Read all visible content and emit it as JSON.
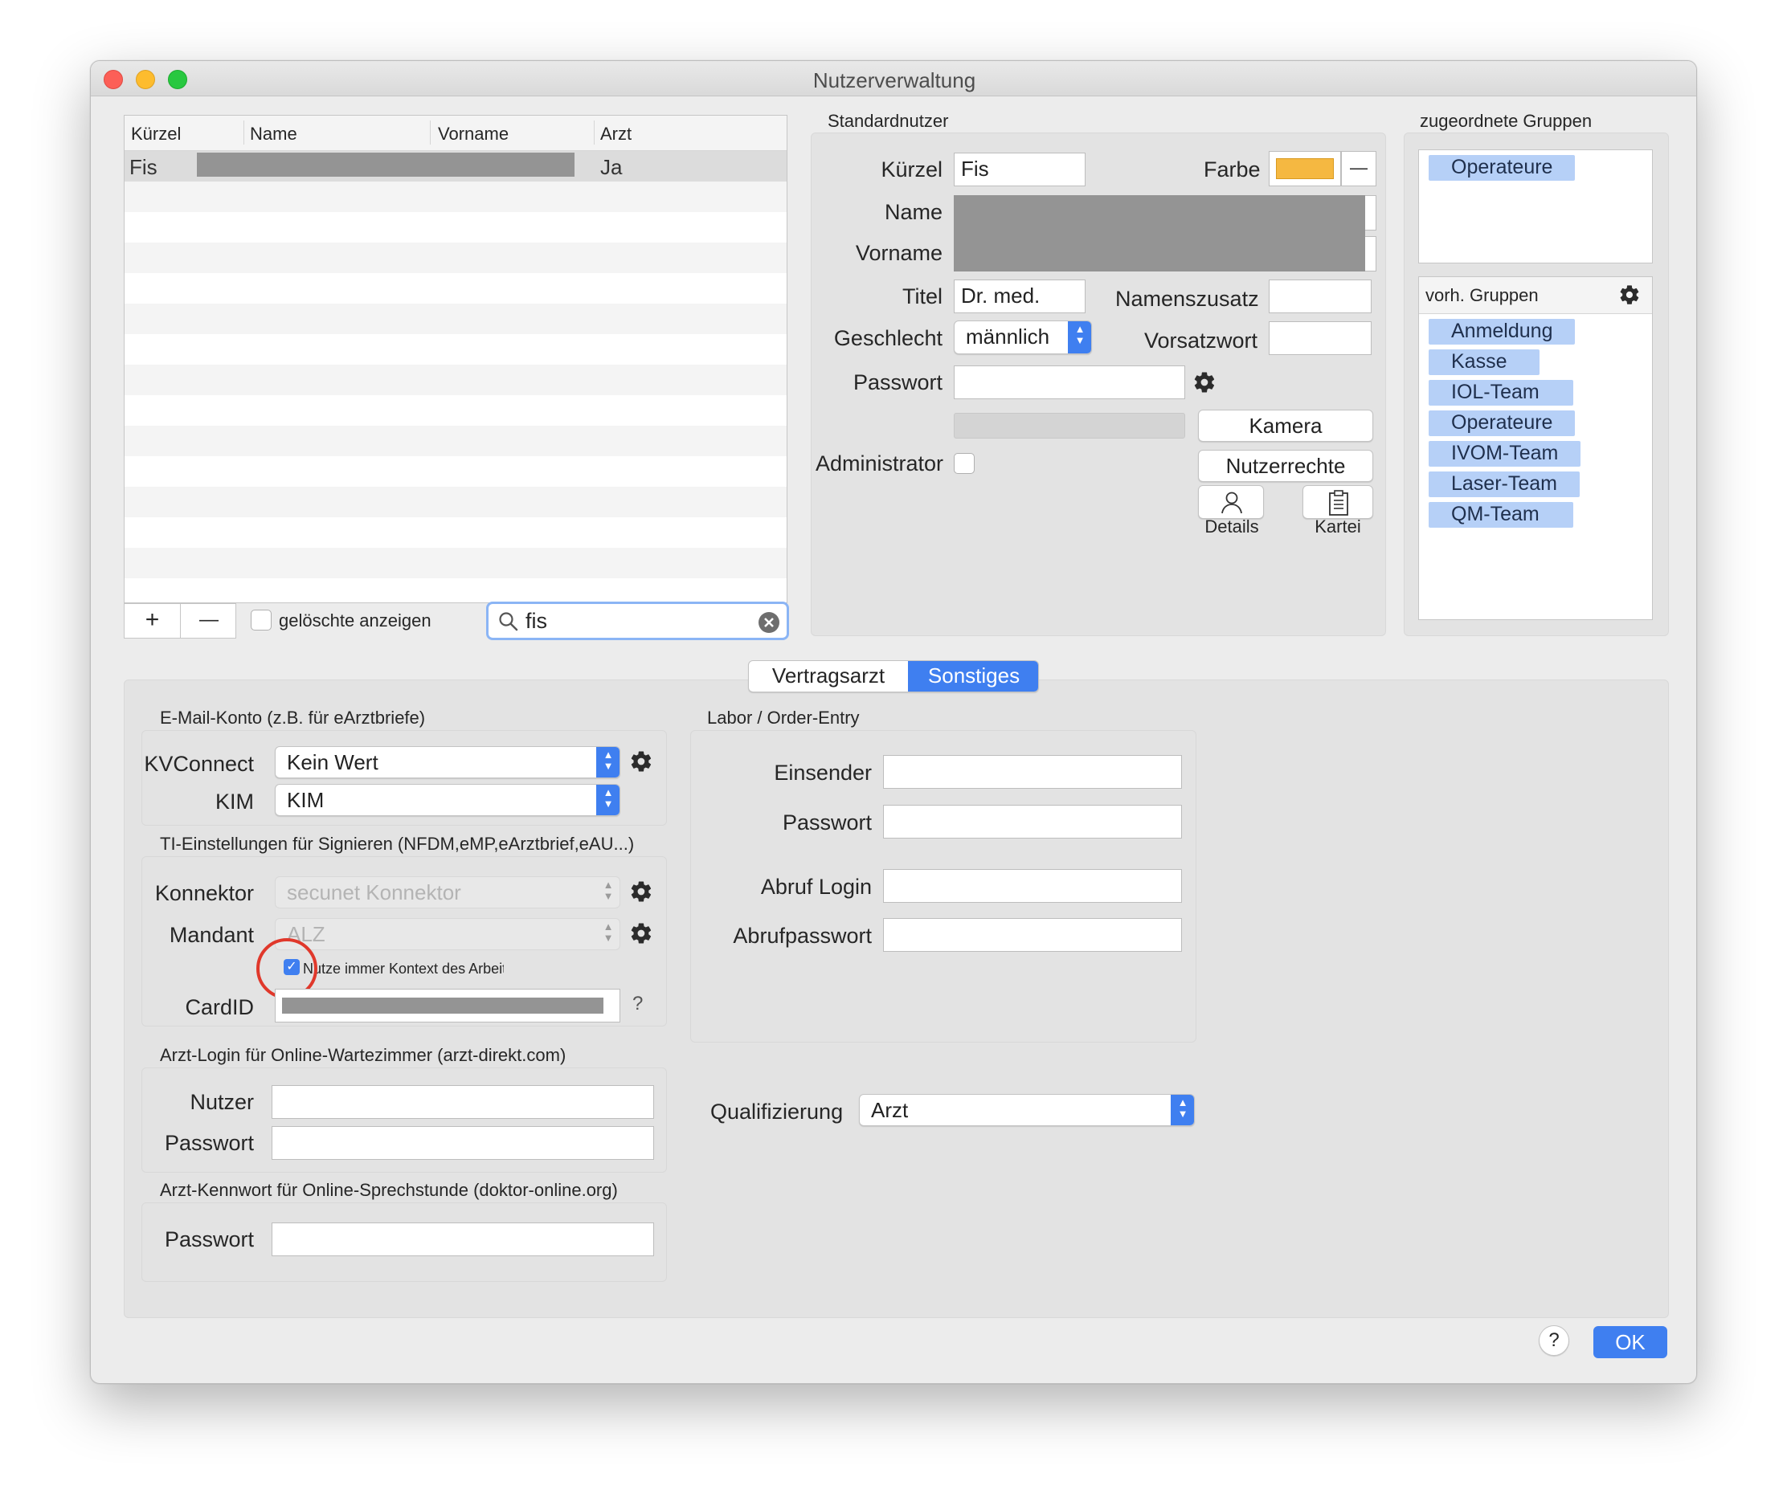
{
  "window": {
    "title": "Nutzerverwaltung"
  },
  "user_table": {
    "columns": [
      "Kürzel",
      "Name",
      "Vorname",
      "Arzt"
    ],
    "rows": [
      {
        "kuerzel": "Fis",
        "arzt": "Ja"
      }
    ],
    "add_label": "+",
    "remove_label": "—",
    "show_deleted_label": "gelöschte anzeigen",
    "search_value": "fis"
  },
  "standard_user": {
    "section_title": "Standardnutzer",
    "kuerzel_label": "Kürzel",
    "kuerzel_value": "Fis",
    "farbe_label": "Farbe",
    "farbe_color": "#f5b841",
    "farbe_remove": "—",
    "name_label": "Name",
    "vorname_label": "Vorname",
    "titel_label": "Titel",
    "titel_value": "Dr. med.",
    "namenszusatz_label": "Namenszusatz",
    "geschlecht_label": "Geschlecht",
    "geschlecht_value": "männlich",
    "vorsatzwort_label": "Vorsatzwort",
    "passwort_label": "Passwort",
    "kamera_label": "Kamera",
    "administrator_label": "Administrator",
    "nutzerrechte_label": "Nutzerrechte",
    "details_label": "Details",
    "kartei_label": "Kartei"
  },
  "groups": {
    "assigned_title": "zugeordnete Gruppen",
    "assigned": [
      "Operateure"
    ],
    "available_title": "vorh. Gruppen",
    "available": [
      "Anmeldung",
      "Kasse",
      "IOL-Team",
      "Operateure",
      "IVOM-Team",
      "Laser-Team",
      "QM-Team"
    ]
  },
  "tabs": [
    {
      "label": "Vertragsarzt",
      "active": false
    },
    {
      "label": "Sonstiges",
      "active": true
    }
  ],
  "email": {
    "section_title": "E-Mail-Konto (z.B. für eArztbriefe)",
    "kvconnect_label": "KVConnect",
    "kvconnect_value": "Kein Wert",
    "kim_label": "KIM",
    "kim_value": "KIM"
  },
  "ti": {
    "section_title": "TI-Einstellungen für Signieren (NFDM,eMP,eArztbrief,eAU...)",
    "konnektor_label": "Konnektor",
    "konnektor_value": "secunet Konnektor",
    "mandant_label": "Mandant",
    "mandant_value": "ALZ",
    "context_checkbox_label": "Nutze immer Kontext des Arbeitsplatzes",
    "context_checked": true,
    "cardid_label": "CardID",
    "cardid_help": "?"
  },
  "arzt_login": {
    "section_title": "Arzt-Login für Online-Wartezimmer (arzt-direkt.com)",
    "nutzer_label": "Nutzer",
    "passwort_label": "Passwort"
  },
  "arzt_kennwort": {
    "section_title": "Arzt-Kennwort für Online-Sprechstunde (doktor-online.org)",
    "passwort_label": "Passwort"
  },
  "labor": {
    "section_title": "Labor / Order-Entry",
    "einsender_label": "Einsender",
    "passwort_label": "Passwort",
    "abruf_login_label": "Abruf Login",
    "abrufpasswort_label": "Abrufpasswort"
  },
  "qualifizierung": {
    "label": "Qualifizierung",
    "value": "Arzt"
  },
  "footer": {
    "help_label": "?",
    "ok_label": "OK"
  },
  "colors": {
    "accent": "#3f7ff0",
    "highlight_ring": "#e0382b",
    "chip": "#b6d0f7"
  }
}
